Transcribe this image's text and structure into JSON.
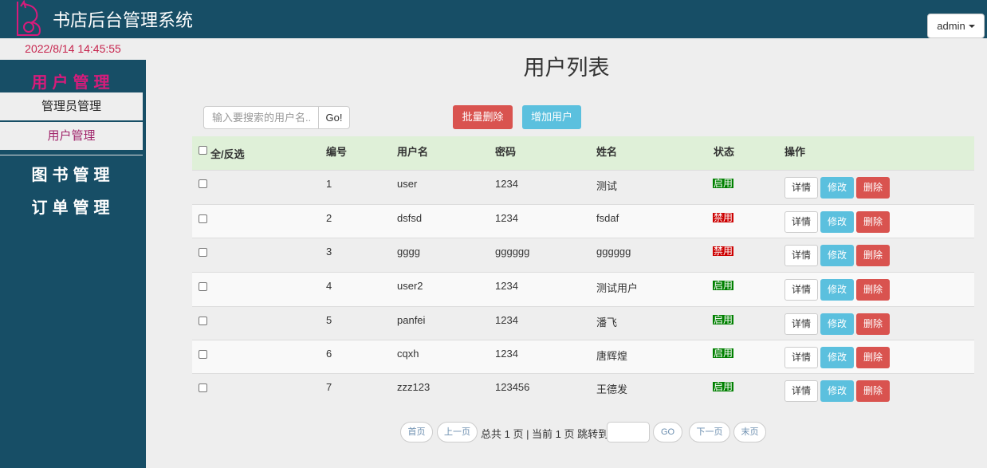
{
  "header": {
    "title": "书店后台管理系统",
    "admin_label": "admin",
    "logo_icon": "bookstore-logo-icon"
  },
  "datetime": "2022/8/14 14:45:55",
  "sidebar": {
    "user_mgmt": "用户管理",
    "sub_admin": "管理员管理",
    "sub_users": "用户管理",
    "book_mgmt": "图书管理",
    "order_mgmt": "订单管理"
  },
  "main": {
    "title": "用户列表",
    "search_placeholder": "输入要搜索的用户名...",
    "go_label": "Go!",
    "batch_delete_label": "批量删除",
    "add_user_label": "增加用户"
  },
  "table": {
    "headers": {
      "select_all": "全/反选",
      "id": "编号",
      "username": "用户名",
      "password": "密码",
      "name": "姓名",
      "status": "状态",
      "actions": "操作"
    },
    "rows": [
      {
        "id": "1",
        "username": "user",
        "password": "1234",
        "name": "测试",
        "status": "启用",
        "active": true
      },
      {
        "id": "2",
        "username": "dsfsd",
        "password": "1234",
        "name": "fsdaf",
        "status": "禁用",
        "active": false
      },
      {
        "id": "3",
        "username": "gggg",
        "password": "gggggg",
        "name": "gggggg",
        "status": "禁用",
        "active": false
      },
      {
        "id": "4",
        "username": "user2",
        "password": "1234",
        "name": "测试用户",
        "status": "启用",
        "active": true
      },
      {
        "id": "5",
        "username": "panfei",
        "password": "1234",
        "name": "潘飞",
        "status": "启用",
        "active": true
      },
      {
        "id": "6",
        "username": "cqxh",
        "password": "1234",
        "name": "唐辉煌",
        "status": "启用",
        "active": true
      },
      {
        "id": "7",
        "username": "zzz123",
        "password": "123456",
        "name": "王德发",
        "status": "启用",
        "active": true
      }
    ],
    "action_labels": {
      "detail": "详情",
      "edit": "修改",
      "delete": "删除"
    }
  },
  "pagination": {
    "first": "首页",
    "prev": "上一页",
    "info": "总共 1 页 | 当前 1 页 跳转到",
    "go": "GO",
    "next": "下一页",
    "last": "末页"
  },
  "colors": {
    "navy": "#174e66",
    "accent": "#d81b7b",
    "danger": "#d9534f",
    "info": "#5bc0de",
    "enabled": "#008000",
    "disabled": "#cc0000"
  }
}
